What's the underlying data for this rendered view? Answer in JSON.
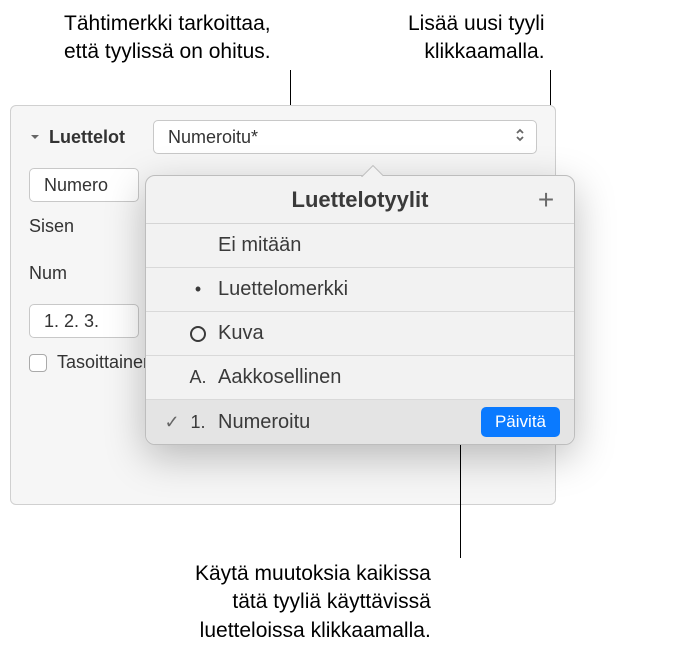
{
  "callouts": {
    "asterisk_line1": "Tähtimerkki tarkoittaa,",
    "asterisk_line2": "että tyylissä on ohitus.",
    "add_line1": "Lisää uusi tyyli",
    "add_line2": "klikkaamalla.",
    "update_line1": "Käytä muutoksia kaikissa",
    "update_line2": "tätä tyyliä käyttävissä",
    "update_line3": "luetteloissa klikkaamalla."
  },
  "panel": {
    "section_label": "Luettelot",
    "main_dropdown_value": "Numeroitu*",
    "sub_dropdown_value": "Numero",
    "indent_label": "Sisen",
    "number_label": "Num",
    "order_dropdown_value": "1. 2. 3.",
    "tiered_checkbox_label": "Tasoittainen numerointi"
  },
  "popover": {
    "title": "Luettelotyylit",
    "add_glyph": "+",
    "items": [
      {
        "marker": "",
        "label": "Ei mitään",
        "selected": false
      },
      {
        "marker": "•",
        "label": "Luettelomerkki",
        "selected": false
      },
      {
        "marker": "circle",
        "label": "Kuva",
        "selected": false
      },
      {
        "marker": "A.",
        "label": "Aakkosellinen",
        "selected": false
      },
      {
        "marker": "1.",
        "label": "Numeroitu",
        "selected": true
      }
    ],
    "check_glyph": "✓",
    "update_label": "Päivitä"
  }
}
